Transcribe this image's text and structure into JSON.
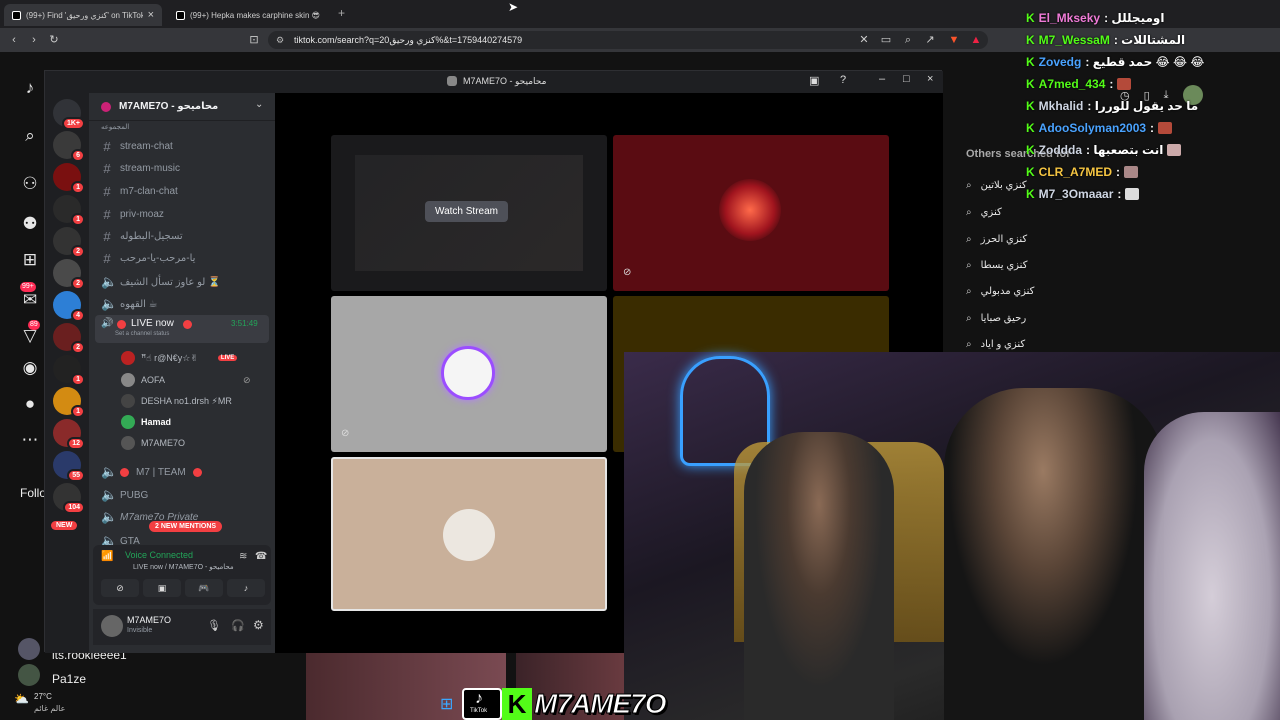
{
  "browser": {
    "tabs": [
      {
        "label": "(99+) Find 'كنزي ورحيق' on TikTok",
        "close": "×"
      },
      {
        "label": "(99+) Hepka makes carphine skin 😎 |",
        "close": ""
      }
    ],
    "new_tab": "+",
    "url": "tiktok.com/search?q=كنزي ورحيق20%&t=1759440274579"
  },
  "tiktok": {
    "notif_count": "99+",
    "other_count": "89",
    "following_label": "Follo",
    "users": [
      "lts.rookieeee1",
      "Pa1ze"
    ],
    "others_searched_label": "Others searched for",
    "suggestions": [
      "كنزي بلاتين",
      "كنزي",
      "كنزي الحرز",
      "كنزي يسطا",
      "كنزي مدبولي",
      "رحيق صبايا",
      "كنزي و اياد"
    ]
  },
  "chat": [
    {
      "user": "El_Mkseky",
      "color": "#f07bd8",
      "msg": ": اوميجللل"
    },
    {
      "user": "M7_WessaM",
      "color": "#53fc18",
      "msg": ": المشتاللات"
    },
    {
      "user": "Zovedg",
      "color": "#4aa3ff",
      "msg": ": حمد قطيع 😂 😂 😂"
    },
    {
      "user": "A7med_434",
      "color": "#53fc18",
      "msg": ":"
    },
    {
      "user": "Mkhalid",
      "color": "#cfd6e3",
      "msg": ": ما حد يقول للوررا"
    },
    {
      "user": "AdooSolyman2003",
      "color": "#4aa3ff",
      "msg": ":"
    },
    {
      "user": "Zoddda",
      "color": "#cfd6e3",
      "msg": ": انت بتصعبها"
    },
    {
      "user": "CLR_A7MED",
      "color": "#f5c542",
      "msg": ":"
    },
    {
      "user": "M7_3Omaaar",
      "color": "#cfd6e3",
      "msg": ":"
    }
  ],
  "discord": {
    "window_title": "M7AME7O - محاميحو",
    "server_name": "M7AME7O - محاميحو",
    "server_badges": [
      "1K+",
      "6",
      "1",
      "1",
      "2",
      "2",
      "2",
      "4",
      "2",
      "1",
      "1",
      "1",
      "12",
      "55",
      "104"
    ],
    "new_label": "NEW",
    "category_partial": "المجموعه",
    "channels": [
      "stream-chat",
      "stream-music",
      "m7-clan-chat",
      "priv-moaz",
      "تسجيل-البطوله",
      "يا-مرحب-يا-مرحب"
    ],
    "voice_channels": [
      "لو عاوز تسأل الشيف ⏳",
      "القهوه ☕"
    ],
    "live_channel": {
      "name": "LIVE now",
      "timer": "3:51:49",
      "status": "Set a channel status"
    },
    "live_users": [
      {
        "name": "ꟸ☝ r@N€y☆✌",
        "live": "LIVE"
      },
      {
        "name": "AOFA",
        "live": ""
      },
      {
        "name": "DESHA no1.drsh ⚡MR",
        "live": ""
      },
      {
        "name": "Hamad",
        "live": ""
      },
      {
        "name": "M7AME7O",
        "live": ""
      }
    ],
    "more_channels": [
      "M7 | TEAM",
      "PUBG",
      "M7ame7o Private",
      "GTA"
    ],
    "mentions_pill": "2 NEW MENTIONS",
    "voice_connected": "Voice Connected",
    "voice_sub": "LIVE now / M7AME7O - محاميحو",
    "user_name": "M7AME7O",
    "user_status": "Invisible",
    "watch_stream": "Watch Stream"
  },
  "taskbar": {
    "temp": "27°C",
    "weather_text": "عالم غائم",
    "streamer_name": "M7AME7O",
    "tiktok_label": "TikTok"
  }
}
